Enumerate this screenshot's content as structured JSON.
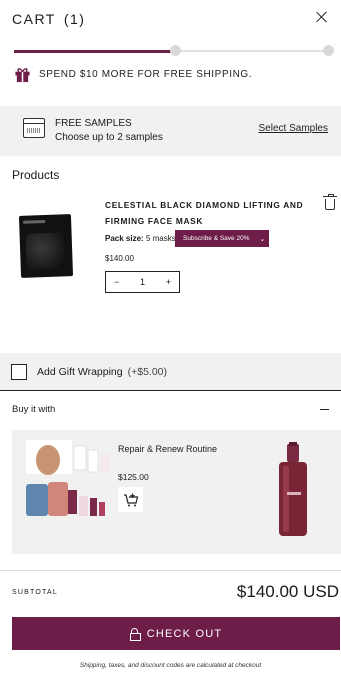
{
  "header": {
    "title": "CART",
    "count": "(1)"
  },
  "shipping": {
    "message": "SPEND $10 MORE FOR FREE SHIPPING.",
    "progress": 0.5
  },
  "samples": {
    "title": "FREE SAMPLES",
    "subtitle": "Choose up to 2 samples",
    "link": "Select Samples"
  },
  "products_label": "Products",
  "product": {
    "name": "CELESTIAL BLACK DIAMOND LIFTING AND FIRMING FACE MASK",
    "pack_label": "Pack size:",
    "pack_value": "5 masks",
    "subscribe": "Subscribe & Save 20%",
    "price": "$140.00",
    "quantity": "1",
    "minus": "−",
    "plus": "+"
  },
  "gift_wrap": {
    "label": "Add Gift Wrapping",
    "price": "(+$5.00)"
  },
  "buy_it_with": {
    "label": "Buy it with",
    "items": [
      {
        "title": "Repair & Renew Routine",
        "price": "$125.00"
      }
    ]
  },
  "subtotal": {
    "label": "SUBTOTAL",
    "value": "$140.00 USD"
  },
  "checkout": {
    "label": "CHECK OUT"
  },
  "footnote": "Shipping, taxes, and discount codes are calculated at checkout",
  "colors": {
    "accent": "#6e1c48",
    "panel": "#f1f1f1"
  },
  "icons": [
    "close-icon",
    "gift-icon",
    "sample-box-icon",
    "trash-icon",
    "chevron-down-icon",
    "add-to-cart-icon",
    "lock-icon",
    "minus-icon"
  ]
}
